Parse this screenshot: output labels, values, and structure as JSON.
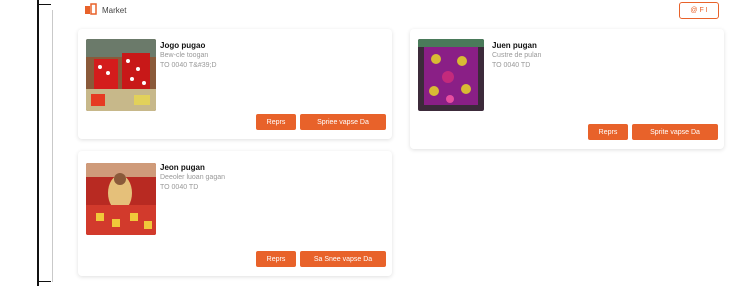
{
  "header": {
    "title": "Market"
  },
  "top_right_button": {
    "label": "@ F I"
  },
  "cards": [
    {
      "name": "Jogo pugao",
      "line1": "Bew-cle toogan",
      "line2": "TO 0040 T&#39;D",
      "button1": "Reprs",
      "button2": "Spriee vapse Da",
      "photo_icon": "red-dotted-fabric-photo"
    },
    {
      "name": "Juen pugan",
      "line1": "Custre de pulan",
      "line2": "TO 0040 TD",
      "button1": "Reprs",
      "button2": "Sprite vapse Da",
      "photo_icon": "purple-fabric-photo"
    },
    {
      "name": "Jeon pugan",
      "line1": "Deeoler luoan gagan",
      "line2": "TO 0040 TD",
      "button1": "Reprs",
      "button2": "Sa Snee vapse Da",
      "photo_icon": "red-yellow-fabric-photo"
    }
  ]
}
